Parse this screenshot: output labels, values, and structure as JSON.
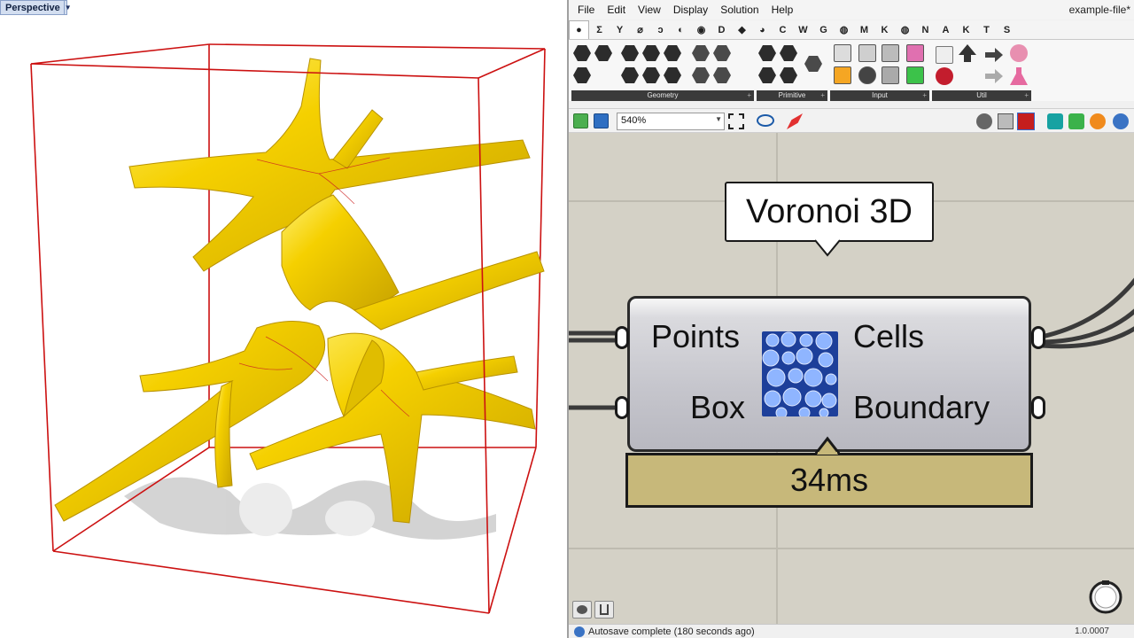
{
  "viewport": {
    "tab_label": "Perspective",
    "object_color": "#f5d000",
    "box_color": "#cc1111"
  },
  "grasshopper": {
    "menu": [
      "File",
      "Edit",
      "View",
      "Display",
      "Solution",
      "Help"
    ],
    "document_title": "example-file*",
    "tabs": [
      "●",
      "Σ",
      "Y",
      "⌀",
      "ↄ",
      "◐",
      "◉",
      "D",
      "◆",
      "◕",
      "C",
      "W",
      "G",
      "◍",
      "M",
      "K",
      "◍",
      "N",
      "A",
      "K",
      "T",
      "S"
    ],
    "ribbon_panels": [
      "Geometry",
      "Primitive",
      "Input",
      "Util"
    ],
    "zoom_value": "540%",
    "status_text": "Autosave complete (180 seconds ago)",
    "version": "1.0.0007",
    "component": {
      "name": "Voronoi 3D",
      "inputs": [
        "Points",
        "Box"
      ],
      "outputs": [
        "Cells",
        "Boundary"
      ],
      "timing": "34ms"
    },
    "colors": {
      "canvas": "#d4d1c6",
      "timer": "#c7b87a",
      "component_body": "#c5c5cc"
    }
  }
}
